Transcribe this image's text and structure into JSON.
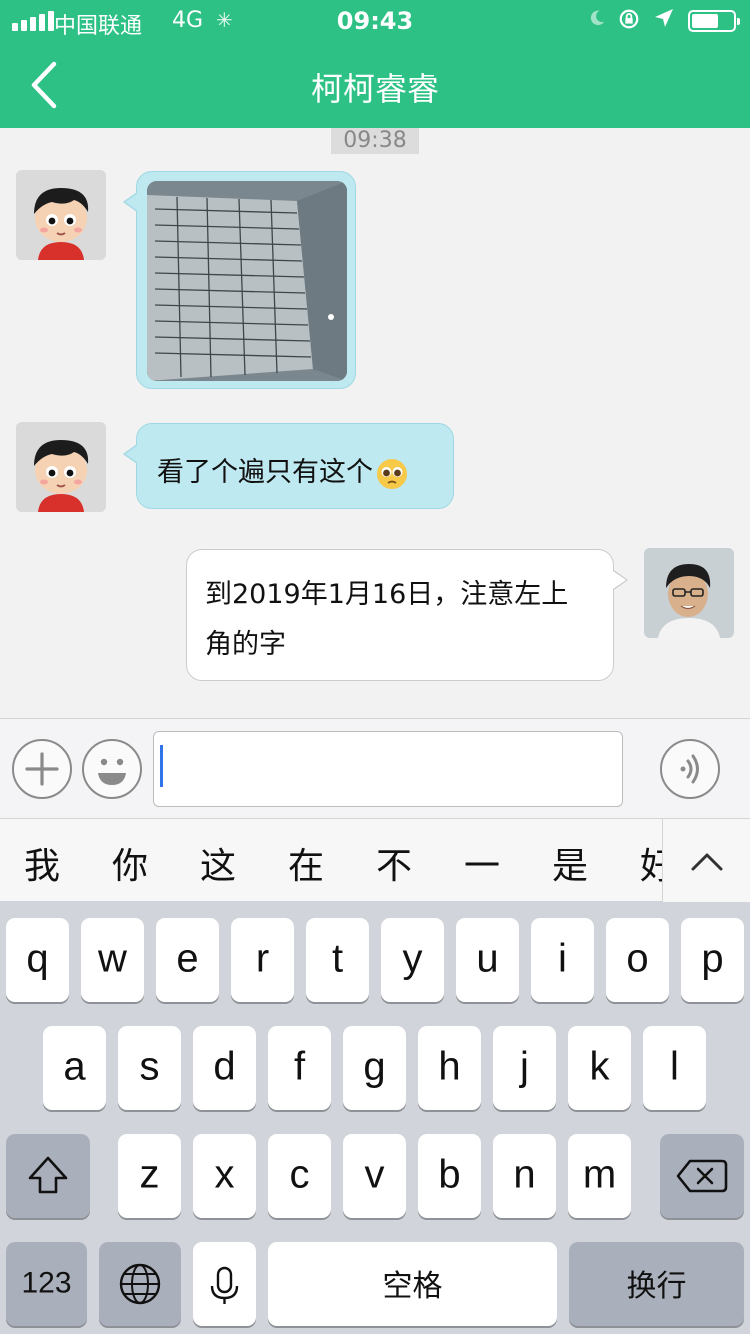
{
  "status_bar": {
    "carrier": "中国联通",
    "network": "4G",
    "time": "09:43"
  },
  "header": {
    "title": "柯柯睿睿"
  },
  "chat": {
    "timestamp": "09:38",
    "messages": [
      {
        "side": "left",
        "type": "image"
      },
      {
        "side": "left",
        "type": "text",
        "text": "看了个遍只有这个"
      },
      {
        "side": "right",
        "type": "text",
        "line1": "到2019年1月16日，注意左上",
        "line2": "角的字"
      }
    ]
  },
  "input_bar": {
    "value": ""
  },
  "candidates": [
    "我",
    "你",
    "这",
    "在",
    "不",
    "一",
    "是",
    "好"
  ],
  "keyboard": {
    "row1": [
      "q",
      "w",
      "e",
      "r",
      "t",
      "y",
      "u",
      "i",
      "o",
      "p"
    ],
    "row2": [
      "a",
      "s",
      "d",
      "f",
      "g",
      "h",
      "j",
      "k",
      "l"
    ],
    "row3": [
      "z",
      "x",
      "c",
      "v",
      "b",
      "n",
      "m"
    ],
    "numbers_label": "123",
    "space_label": "空格",
    "return_label": "换行"
  },
  "colors": {
    "header_green": "#2dc185",
    "incoming_bubble": "#bfe9f1",
    "outgoing_bubble": "#ffffff",
    "caret_blue": "#2f74e9"
  }
}
